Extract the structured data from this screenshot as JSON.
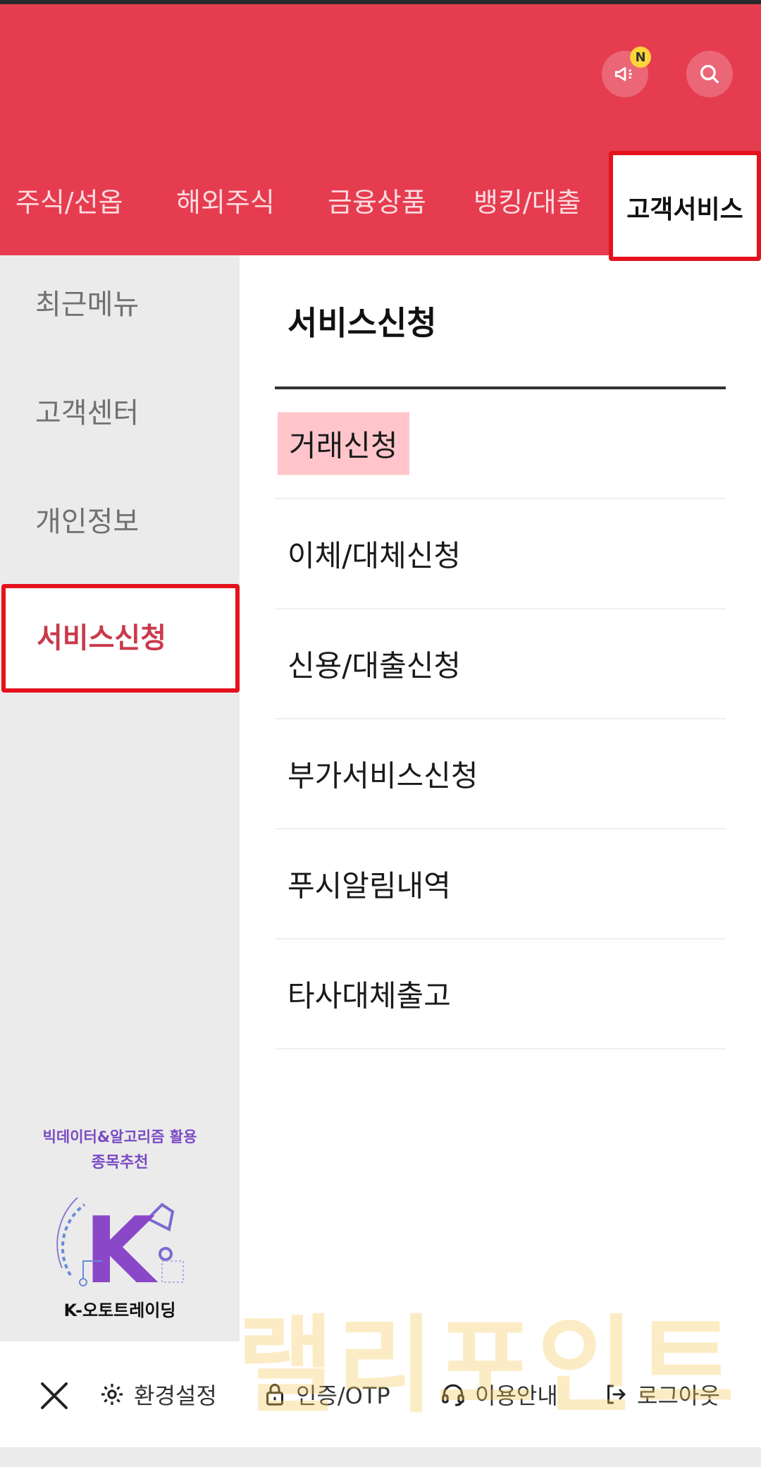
{
  "header": {
    "new_badge": "N",
    "tabs": [
      "주식/선옵",
      "해외주식",
      "금융상품",
      "뱅킹/대출",
      "고객서비스"
    ]
  },
  "sidebar": {
    "items": [
      "최근메뉴",
      "고객센터",
      "개인정보",
      "서비스신청"
    ],
    "promo": {
      "line1": "빅데이터&알고리즘 활용",
      "line2": "종목추천",
      "logo_letter": "K",
      "name": "K-오토트레이딩"
    }
  },
  "content": {
    "section_title": "서비스신청",
    "items": [
      "거래신청",
      "이체/대체신청",
      "신용/대출신청",
      "부가서비스신청",
      "푸시알림내역",
      "타사대체출고"
    ]
  },
  "bottom": {
    "settings": "환경설정",
    "auth": "인증/OTP",
    "guide": "이용안내",
    "logout": "로그아웃"
  },
  "watermark": "랠리포인트",
  "colors": {
    "brand_red": "#e63c50",
    "highlight_border": "#e4121c",
    "active_text": "#c93a4b",
    "highlight_bg": "#ffc5cb"
  },
  "icons": [
    "notice-icon",
    "search-icon",
    "close-icon",
    "gear-icon",
    "lock-icon",
    "headset-icon",
    "logout-icon"
  ]
}
